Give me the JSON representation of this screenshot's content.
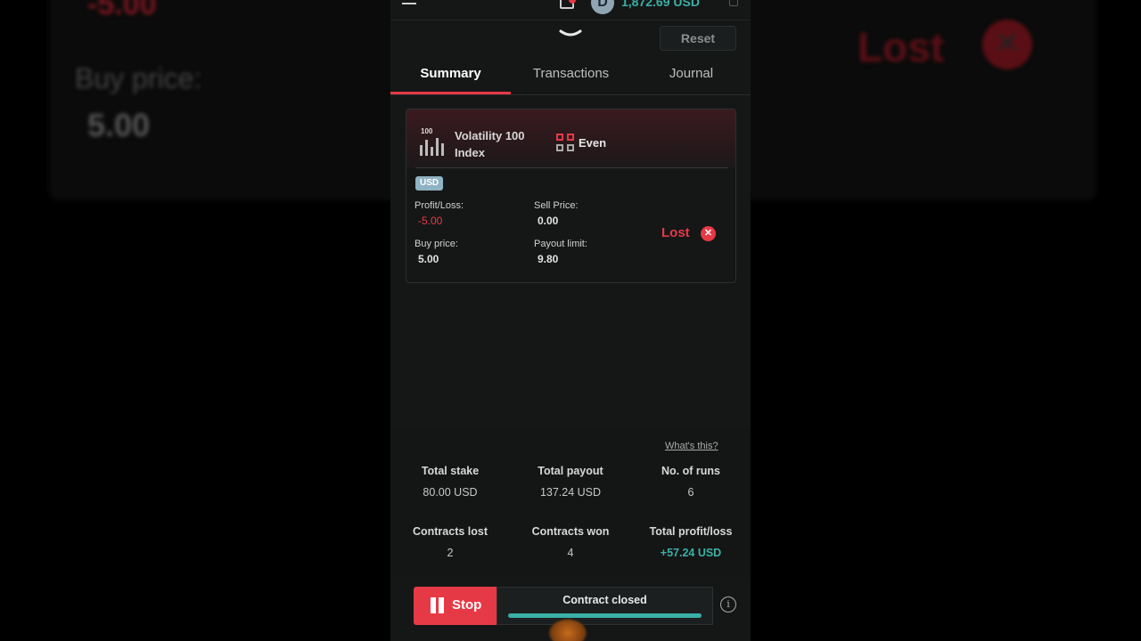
{
  "background": {
    "loss_value": "-5.00",
    "buy_price_label": "Buy price:",
    "buy_price_value": "5.00",
    "status": "Lost"
  },
  "header": {
    "balance": "1,872.69 USD",
    "reset_label": "Reset"
  },
  "tabs": [
    {
      "label": "Summary",
      "active": true
    },
    {
      "label": "Transactions",
      "active": false
    },
    {
      "label": "Journal",
      "active": false
    }
  ],
  "contract": {
    "asset_tag": "100",
    "asset_name": "Volatility 100 Index",
    "trade_type": "Even",
    "currency": "USD",
    "profit_loss_label": "Profit/Loss:",
    "profit_loss_value": "-5.00",
    "sell_price_label": "Sell Price:",
    "sell_price_value": "0.00",
    "buy_price_label": "Buy price:",
    "buy_price_value": "5.00",
    "payout_limit_label": "Payout limit:",
    "payout_limit_value": "9.80",
    "status": "Lost"
  },
  "stats": {
    "whats_this": "What's this?",
    "total_stake_label": "Total stake",
    "total_stake_value": "80.00 USD",
    "total_payout_label": "Total payout",
    "total_payout_value": "137.24 USD",
    "runs_label": "No. of runs",
    "runs_value": "6",
    "lost_label": "Contracts lost",
    "lost_value": "2",
    "won_label": "Contracts won",
    "won_value": "4",
    "profit_label": "Total profit/loss",
    "profit_value": "+57.24 USD"
  },
  "footer": {
    "stop_label": "Stop",
    "contract_status": "Contract closed",
    "progress": 1.0
  },
  "colors": {
    "accent_red": "#e63946",
    "accent_teal": "#3ab0a6"
  }
}
